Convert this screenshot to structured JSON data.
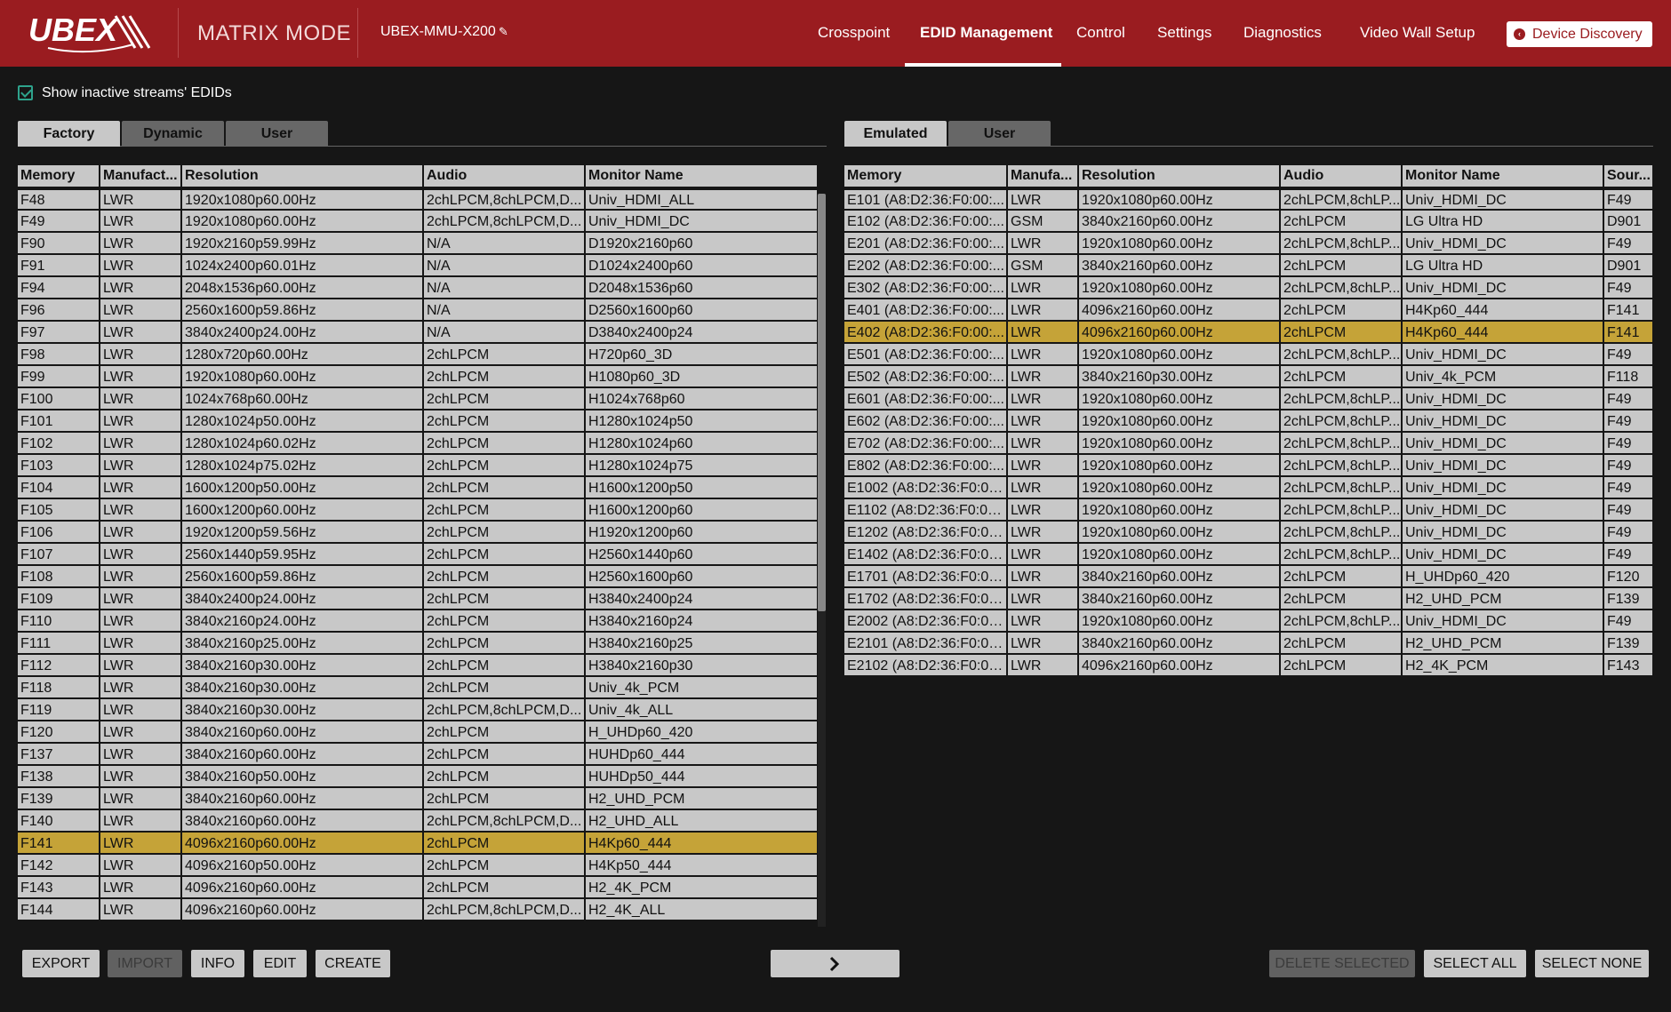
{
  "header": {
    "logo_text": "UBEX",
    "mode": "MATRIX MODE",
    "device_name": "UBEX-MMU-X200",
    "nav": [
      "Crosspoint",
      "EDID Management",
      "Control",
      "Settings",
      "Diagnostics",
      "Video Wall Setup"
    ],
    "active_nav": "EDID Management",
    "discovery_label": "Device Discovery"
  },
  "options": {
    "show_inactive_label": "Show inactive streams' EDIDs",
    "show_inactive_checked": true
  },
  "left_panel": {
    "tabs": [
      "Factory",
      "Dynamic",
      "User"
    ],
    "active_tab": "Factory",
    "columns": [
      "Memory",
      "Manufact...",
      "Resolution",
      "Audio",
      "Monitor Name"
    ],
    "rows": [
      [
        "F48",
        "LWR",
        "1920x1080p60.00Hz",
        "2chLPCM,8chLPCM,D...",
        "Univ_HDMI_ALL"
      ],
      [
        "F49",
        "LWR",
        "1920x1080p60.00Hz",
        "2chLPCM,8chLPCM,D...",
        "Univ_HDMI_DC"
      ],
      [
        "F90",
        "LWR",
        "1920x2160p59.99Hz",
        "N/A",
        "D1920x2160p60"
      ],
      [
        "F91",
        "LWR",
        "1024x2400p60.01Hz",
        "N/A",
        "D1024x2400p60"
      ],
      [
        "F94",
        "LWR",
        "2048x1536p60.00Hz",
        "N/A",
        "D2048x1536p60"
      ],
      [
        "F96",
        "LWR",
        "2560x1600p59.86Hz",
        "N/A",
        "D2560x1600p60"
      ],
      [
        "F97",
        "LWR",
        "3840x2400p24.00Hz",
        "N/A",
        "D3840x2400p24"
      ],
      [
        "F98",
        "LWR",
        "1280x720p60.00Hz",
        "2chLPCM",
        "H720p60_3D"
      ],
      [
        "F99",
        "LWR",
        "1920x1080p60.00Hz",
        "2chLPCM",
        "H1080p60_3D"
      ],
      [
        "F100",
        "LWR",
        "1024x768p60.00Hz",
        "2chLPCM",
        "H1024x768p60"
      ],
      [
        "F101",
        "LWR",
        "1280x1024p50.00Hz",
        "2chLPCM",
        "H1280x1024p50"
      ],
      [
        "F102",
        "LWR",
        "1280x1024p60.02Hz",
        "2chLPCM",
        "H1280x1024p60"
      ],
      [
        "F103",
        "LWR",
        "1280x1024p75.02Hz",
        "2chLPCM",
        "H1280x1024p75"
      ],
      [
        "F104",
        "LWR",
        "1600x1200p50.00Hz",
        "2chLPCM",
        "H1600x1200p50"
      ],
      [
        "F105",
        "LWR",
        "1600x1200p60.00Hz",
        "2chLPCM",
        "H1600x1200p60"
      ],
      [
        "F106",
        "LWR",
        "1920x1200p59.56Hz",
        "2chLPCM",
        "H1920x1200p60"
      ],
      [
        "F107",
        "LWR",
        "2560x1440p59.95Hz",
        "2chLPCM",
        "H2560x1440p60"
      ],
      [
        "F108",
        "LWR",
        "2560x1600p59.86Hz",
        "2chLPCM",
        "H2560x1600p60"
      ],
      [
        "F109",
        "LWR",
        "3840x2400p24.00Hz",
        "2chLPCM",
        "H3840x2400p24"
      ],
      [
        "F110",
        "LWR",
        "3840x2160p24.00Hz",
        "2chLPCM",
        "H3840x2160p24"
      ],
      [
        "F111",
        "LWR",
        "3840x2160p25.00Hz",
        "2chLPCM",
        "H3840x2160p25"
      ],
      [
        "F112",
        "LWR",
        "3840x2160p30.00Hz",
        "2chLPCM",
        "H3840x2160p30"
      ],
      [
        "F118",
        "LWR",
        "3840x2160p30.00Hz",
        "2chLPCM",
        "Univ_4k_PCM"
      ],
      [
        "F119",
        "LWR",
        "3840x2160p30.00Hz",
        "2chLPCM,8chLPCM,D...",
        "Univ_4k_ALL"
      ],
      [
        "F120",
        "LWR",
        "3840x2160p60.00Hz",
        "2chLPCM",
        "H_UHDp60_420"
      ],
      [
        "F137",
        "LWR",
        "3840x2160p60.00Hz",
        "2chLPCM",
        "HUHDp60_444"
      ],
      [
        "F138",
        "LWR",
        "3840x2160p50.00Hz",
        "2chLPCM",
        "HUHDp50_444"
      ],
      [
        "F139",
        "LWR",
        "3840x2160p60.00Hz",
        "2chLPCM",
        "H2_UHD_PCM"
      ],
      [
        "F140",
        "LWR",
        "3840x2160p60.00Hz",
        "2chLPCM,8chLPCM,D...",
        "H2_UHD_ALL"
      ],
      [
        "F141",
        "LWR",
        "4096x2160p60.00Hz",
        "2chLPCM",
        "H4Kp60_444"
      ],
      [
        "F142",
        "LWR",
        "4096x2160p50.00Hz",
        "2chLPCM",
        "H4Kp50_444"
      ],
      [
        "F143",
        "LWR",
        "4096x2160p60.00Hz",
        "2chLPCM",
        "H2_4K_PCM"
      ],
      [
        "F144",
        "LWR",
        "4096x2160p60.00Hz",
        "2chLPCM,8chLPCM,D...",
        "H2_4K_ALL"
      ]
    ],
    "selected_memory": "F141"
  },
  "right_panel": {
    "tabs": [
      "Emulated",
      "User"
    ],
    "active_tab": "Emulated",
    "columns": [
      "Memory",
      "Manufa...",
      "Resolution",
      "Audio",
      "Monitor Name",
      "Sour..."
    ],
    "rows": [
      [
        "E101 (A8:D2:36:F0:00:...",
        "LWR",
        "1920x1080p60.00Hz",
        "2chLPCM,8chLP...",
        "Univ_HDMI_DC",
        "F49"
      ],
      [
        "E102 (A8:D2:36:F0:00:...",
        "GSM",
        "3840x2160p60.00Hz",
        "2chLPCM",
        "LG Ultra HD",
        "D901"
      ],
      [
        "E201 (A8:D2:36:F0:00:...",
        "LWR",
        "1920x1080p60.00Hz",
        "2chLPCM,8chLP...",
        "Univ_HDMI_DC",
        "F49"
      ],
      [
        "E202 (A8:D2:36:F0:00:...",
        "GSM",
        "3840x2160p60.00Hz",
        "2chLPCM",
        "LG Ultra HD",
        "D901"
      ],
      [
        "E302 (A8:D2:36:F0:00:...",
        "LWR",
        "1920x1080p60.00Hz",
        "2chLPCM,8chLP...",
        "Univ_HDMI_DC",
        "F49"
      ],
      [
        "E401 (A8:D2:36:F0:00:...",
        "LWR",
        "4096x2160p60.00Hz",
        "2chLPCM",
        "H4Kp60_444",
        "F141"
      ],
      [
        "E402 (A8:D2:36:F0:00:...",
        "LWR",
        "4096x2160p60.00Hz",
        "2chLPCM",
        "H4Kp60_444",
        "F141"
      ],
      [
        "E501 (A8:D2:36:F0:00:...",
        "LWR",
        "1920x1080p60.00Hz",
        "2chLPCM,8chLP...",
        "Univ_HDMI_DC",
        "F49"
      ],
      [
        "E502 (A8:D2:36:F0:00:...",
        "LWR",
        "3840x2160p30.00Hz",
        "2chLPCM",
        "Univ_4k_PCM",
        "F118"
      ],
      [
        "E601 (A8:D2:36:F0:00:...",
        "LWR",
        "1920x1080p60.00Hz",
        "2chLPCM,8chLP...",
        "Univ_HDMI_DC",
        "F49"
      ],
      [
        "E602 (A8:D2:36:F0:00:...",
        "LWR",
        "1920x1080p60.00Hz",
        "2chLPCM,8chLP...",
        "Univ_HDMI_DC",
        "F49"
      ],
      [
        "E702 (A8:D2:36:F0:00:...",
        "LWR",
        "1920x1080p60.00Hz",
        "2chLPCM,8chLP...",
        "Univ_HDMI_DC",
        "F49"
      ],
      [
        "E802 (A8:D2:36:F0:00:...",
        "LWR",
        "1920x1080p60.00Hz",
        "2chLPCM,8chLP...",
        "Univ_HDMI_DC",
        "F49"
      ],
      [
        "E1002 (A8:D2:36:F0:00...",
        "LWR",
        "1920x1080p60.00Hz",
        "2chLPCM,8chLP...",
        "Univ_HDMI_DC",
        "F49"
      ],
      [
        "E1102 (A8:D2:36:F0:00...",
        "LWR",
        "1920x1080p60.00Hz",
        "2chLPCM,8chLP...",
        "Univ_HDMI_DC",
        "F49"
      ],
      [
        "E1202 (A8:D2:36:F0:00...",
        "LWR",
        "1920x1080p60.00Hz",
        "2chLPCM,8chLP...",
        "Univ_HDMI_DC",
        "F49"
      ],
      [
        "E1402 (A8:D2:36:F0:00...",
        "LWR",
        "1920x1080p60.00Hz",
        "2chLPCM,8chLP...",
        "Univ_HDMI_DC",
        "F49"
      ],
      [
        "E1701 (A8:D2:36:F0:00...",
        "LWR",
        "3840x2160p60.00Hz",
        "2chLPCM",
        "H_UHDp60_420",
        "F120"
      ],
      [
        "E1702 (A8:D2:36:F0:00...",
        "LWR",
        "3840x2160p60.00Hz",
        "2chLPCM",
        "H2_UHD_PCM",
        "F139"
      ],
      [
        "E2002 (A8:D2:36:F0:00...",
        "LWR",
        "1920x1080p60.00Hz",
        "2chLPCM,8chLP...",
        "Univ_HDMI_DC",
        "F49"
      ],
      [
        "E2101 (A8:D2:36:F0:00...",
        "LWR",
        "3840x2160p60.00Hz",
        "2chLPCM",
        "H2_UHD_PCM",
        "F139"
      ],
      [
        "E2102 (A8:D2:36:F0:00...",
        "LWR",
        "4096x2160p60.00Hz",
        "2chLPCM",
        "H2_4K_PCM",
        "F143"
      ]
    ],
    "selected_memory_prefix": "E402"
  },
  "buttons": {
    "export": "EXPORT",
    "import": "IMPORT",
    "info": "INFO",
    "edit": "EDIT",
    "create": "CREATE",
    "delete_selected": "DELETE SELECTED",
    "select_all": "SELECT ALL",
    "select_none": "SELECT NONE"
  },
  "colors": {
    "header_bg": "#9a1c20",
    "selection": "#c5a338",
    "row_bg": "#c8c8c8",
    "checkbox": "#2ea38c"
  }
}
